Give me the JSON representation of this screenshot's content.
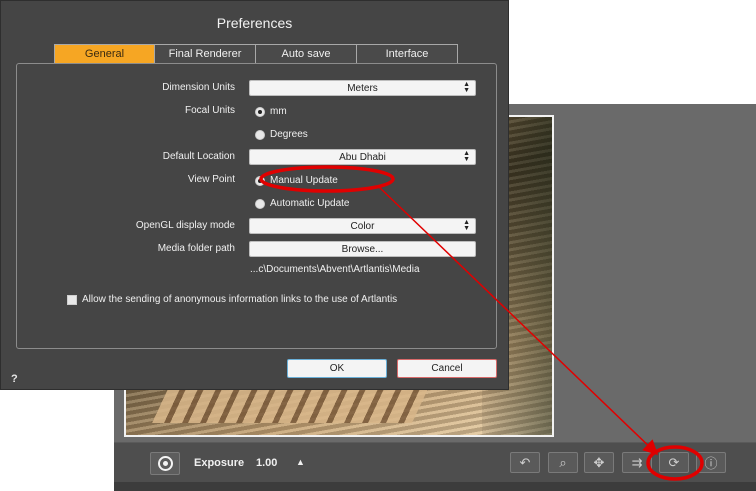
{
  "dialog": {
    "title": "Preferences",
    "tabs": [
      {
        "label": "General",
        "active": true
      },
      {
        "label": "Final Renderer",
        "active": false
      },
      {
        "label": "Auto save",
        "active": false
      },
      {
        "label": "Interface",
        "active": false
      }
    ],
    "dimension_units": {
      "label": "Dimension Units",
      "value": "Meters"
    },
    "focal_units": {
      "label": "Focal Units",
      "options": [
        "mm",
        "Degrees"
      ],
      "selected": "mm"
    },
    "default_location": {
      "label": "Default Location",
      "value": "Abu Dhabi"
    },
    "view_point": {
      "label": "View Point",
      "options": [
        "Manual Update",
        "Automatic Update"
      ],
      "selected": "Manual Update"
    },
    "opengl_mode": {
      "label": "OpenGL display mode",
      "value": "Color"
    },
    "media_folder": {
      "label": "Media folder path",
      "button": "Browse...",
      "path": "...c\\Documents\\Abvent\\Artlantis\\Media"
    },
    "anonymous_info": {
      "label": "Allow the sending of anonymous information links to the use of Artlantis",
      "checked": false
    },
    "ok_label": "OK",
    "cancel_label": "Cancel",
    "help_label": "?"
  },
  "bottombar": {
    "exposure_label": "Exposure",
    "exposure_value": "1.00",
    "exposure_up": "▲",
    "tools": [
      {
        "icon": "undo-icon",
        "glyph": "↶"
      },
      {
        "icon": "zoom-icon",
        "glyph": "⌕"
      },
      {
        "icon": "pan-icon",
        "glyph": "✥"
      },
      {
        "icon": "camera-move-icon",
        "glyph": "⇉"
      },
      {
        "icon": "refresh-icon",
        "glyph": "⟳"
      },
      {
        "icon": "info-icon",
        "glyph": "ⓘ"
      }
    ]
  },
  "colors": {
    "accent_tab": "#f6a623",
    "annotation": "#e00000",
    "ok_border": "#6ab0d8",
    "cancel_border": "#d86a6a"
  }
}
